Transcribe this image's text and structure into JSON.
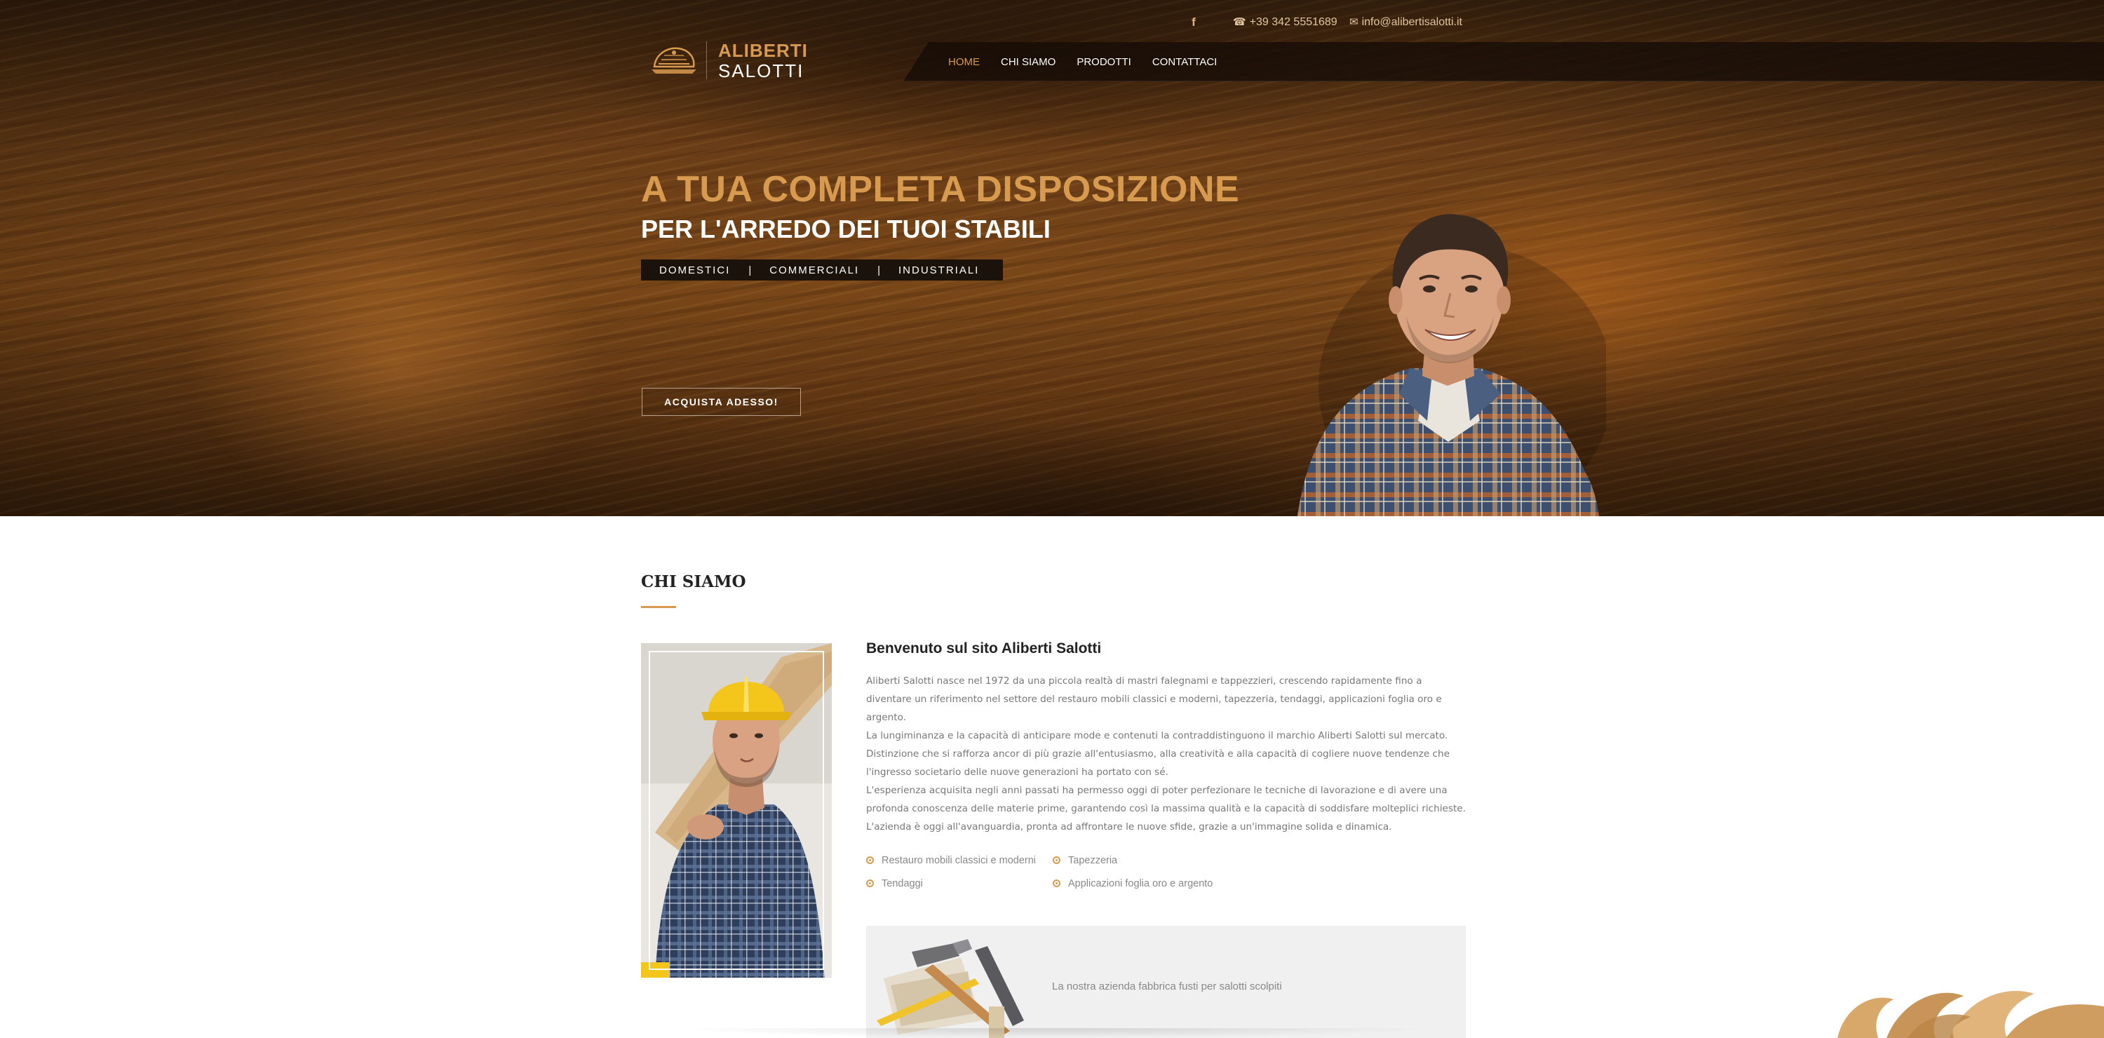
{
  "topbar": {
    "facebook_icon": "facebook-icon",
    "phone": "+39 342 5551689",
    "email": "info@alibertisalotti.it"
  },
  "logo": {
    "line1": "ALIBERTI",
    "line2": "SALOTTI"
  },
  "nav": {
    "items": [
      {
        "label": "HOME",
        "active": true
      },
      {
        "label": "CHI SIAMO",
        "active": false
      },
      {
        "label": "PRODOTTI",
        "active": false
      },
      {
        "label": "CONTATTACI",
        "active": false
      }
    ]
  },
  "hero": {
    "title": "A TUA COMPLETA DISPOSIZIONE",
    "subtitle": "PER L'ARREDO DEI TUOI STABILI",
    "tags": [
      "DOMESTICI",
      "COMMERCIALI",
      "INDUSTRIALI"
    ],
    "separator": "|",
    "cta": "ACQUISTA ADESSO!"
  },
  "about": {
    "section_title": "CHI SIAMO",
    "heading": "Benvenuto sul sito Aliberti Salotti",
    "paragraphs": [
      "Aliberti Salotti nasce nel 1972 da una piccola realtà di mastri falegnami e tappezzieri, crescendo rapidamente fino a diventare un riferimento nel settore del restauro mobili classici e moderni, tapezzeria, tendaggi, applicazioni foglia oro e argento.",
      "La lungiminanza e la capacità di anticipare mode e contenuti la contraddistinguono il marchio Aliberti Salotti sul mercato. Distinzione che si rafforza ancor di più grazie all'entusiasmo, alla creatività e alla capacità di cogliere nuove tendenze che l'ingresso societario delle nuove generazioni ha portato con sé.",
      "L'esperienza acquisita negli anni passati ha permesso oggi di poter perfezionare le tecniche di lavorazione e di avere una profonda conoscenza delle materie prime, garantendo così la massima qualità e la capacità di soddisfare molteplici richieste.",
      "L'azienda è oggi all'avanguardia, pronta ad affrontare le nuove sfide, grazie a un'immagine solida e dinamica."
    ],
    "features": [
      "Restauro mobili classici e moderni",
      "Tapezzeria",
      "Tendaggi",
      "Applicazioni foglia oro e argento"
    ],
    "promo_text": "La nostra azienda fabbrica fusti per salotti scolpiti"
  },
  "colors": {
    "accent": "#d89a4f",
    "nav_bg": "#1b120b",
    "text_muted": "#777777"
  }
}
